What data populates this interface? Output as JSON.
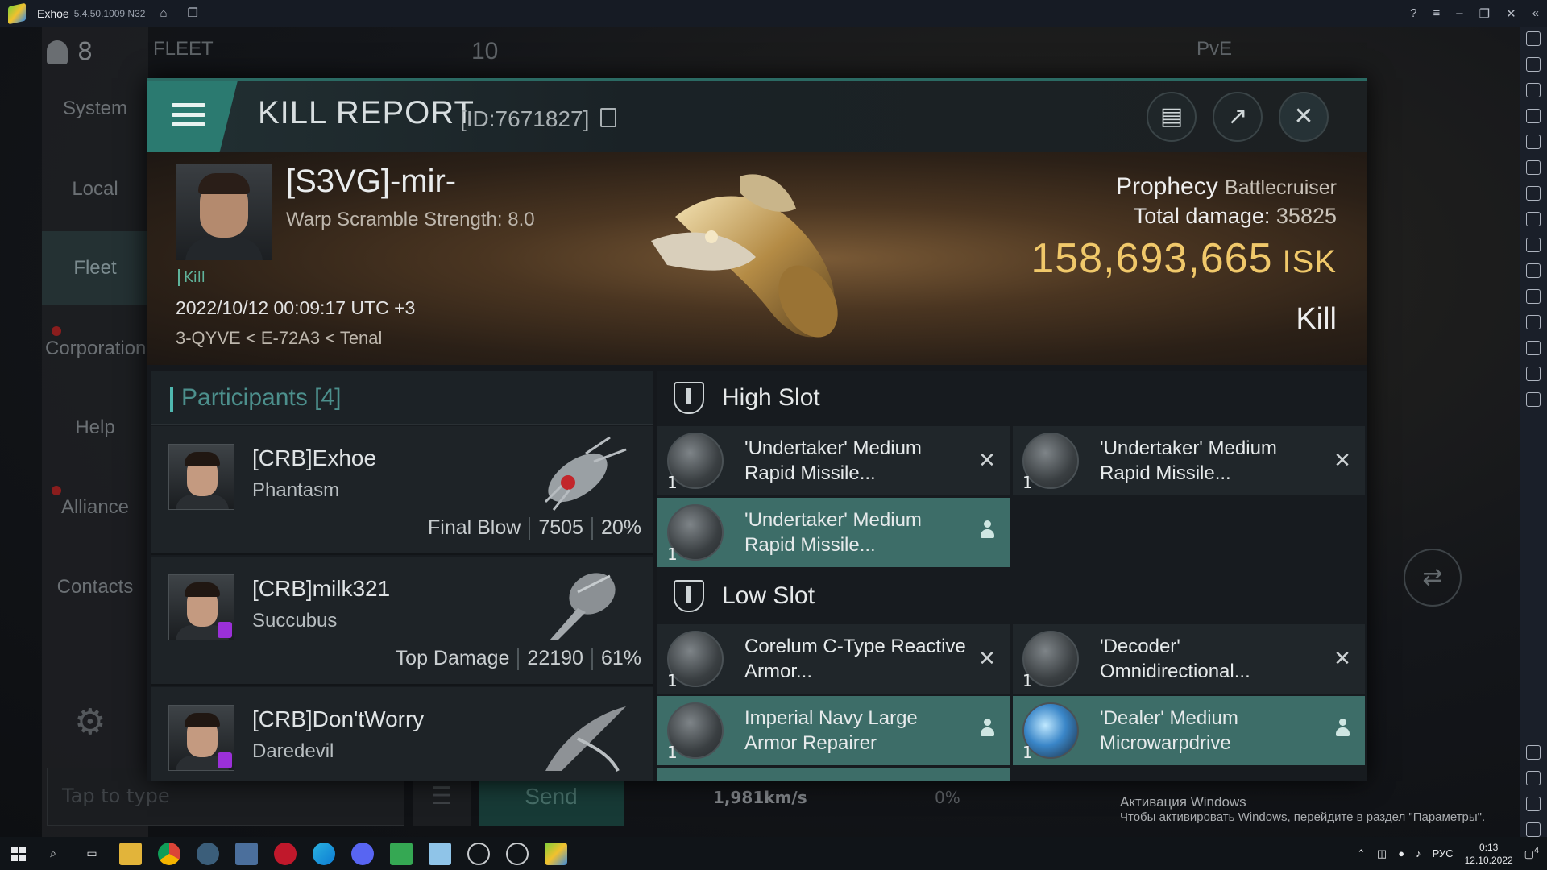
{
  "titlebar": {
    "app": "Exhoe",
    "version": "5.4.50.1009 N32"
  },
  "background": {
    "member_count": "8",
    "fleet_label": "FLEET",
    "fleet_count": "10",
    "filter_label": "PvE",
    "nav": [
      "System",
      "Local",
      "Fleet",
      "Corporation",
      "Help",
      "Alliance",
      "Contacts"
    ],
    "chat_placeholder": "Tap to type",
    "send_label": "Send",
    "speed": "1,981km/s",
    "speed_pct": "0%"
  },
  "report": {
    "title": "KILL REPORT",
    "id": "[ID:7671827]",
    "victim": {
      "name": "[S3VG]-mir-",
      "scramble": "Warp Scramble Strength: 8.0",
      "badge": "Kill",
      "datetime": "2022/10/12 00:09:17 UTC +3",
      "location": "3-QYVE < E-72A3 < Tenal",
      "ship": "Prophecy",
      "ship_class": "Battlecruiser",
      "damage_label": "Total damage:",
      "damage": "35825",
      "isk": "158,693,665",
      "isk_unit": "ISK",
      "type": "Kill"
    },
    "participants_title": "Participants [4]",
    "participants": [
      {
        "name": "[CRB]Exhoe",
        "ship": "Phantasm",
        "label": "Final Blow",
        "damage": "7505",
        "pct": "20%"
      },
      {
        "name": "[CRB]milk321",
        "ship": "Succubus",
        "label": "Top Damage",
        "damage": "22190",
        "pct": "61%"
      },
      {
        "name": "[CRB]Don'tWorry",
        "ship": "Daredevil",
        "label": "",
        "damage": "",
        "pct": ""
      }
    ],
    "high_slot_title": "High Slot",
    "low_slot_title": "Low Slot",
    "high_slot": [
      {
        "name": "'Undertaker' Medium Rapid Missile...",
        "qty": "1",
        "status": "destroyed"
      },
      {
        "name": "'Undertaker' Medium Rapid Missile...",
        "qty": "1",
        "status": "destroyed"
      },
      {
        "name": "'Undertaker' Medium Rapid Missile...",
        "qty": "1",
        "status": "dropped"
      }
    ],
    "low_slot": [
      {
        "name": "Corelum C-Type Reactive Armor...",
        "qty": "1",
        "status": "destroyed"
      },
      {
        "name": "'Decoder' Omnidirectional...",
        "qty": "1",
        "status": "destroyed"
      },
      {
        "name": "Imperial Navy Large Armor Repairer",
        "qty": "1",
        "status": "dropped"
      },
      {
        "name": "'Dealer' Medium Microwarpdrive",
        "qty": "1",
        "status": "dropped"
      }
    ]
  },
  "watermark": {
    "line1": "Активация Windows",
    "line2": "Чтобы активировать Windows, перейдите в раздел \"Параметры\"."
  },
  "taskbar": {
    "lang": "РУС",
    "time": "0:13",
    "date": "12.10.2022",
    "notif": "4"
  }
}
